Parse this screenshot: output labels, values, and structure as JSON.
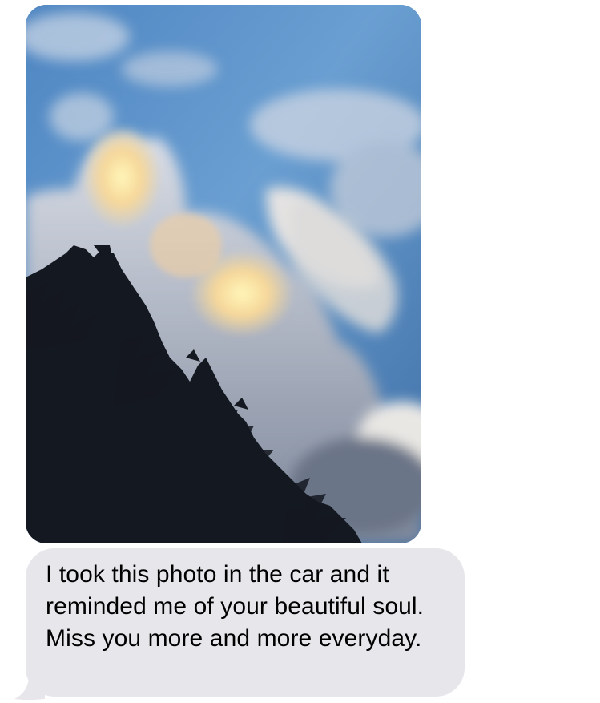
{
  "conversation": {
    "photo": {
      "description_icon": "sky-photo"
    },
    "message": {
      "text": "I took this photo in the car and it reminded me of your beautiful soul. Miss you more and more everyday."
    }
  },
  "colors": {
    "received_bubble": "#e6e6eb",
    "message_text": "#000000",
    "background": "#ffffff"
  }
}
